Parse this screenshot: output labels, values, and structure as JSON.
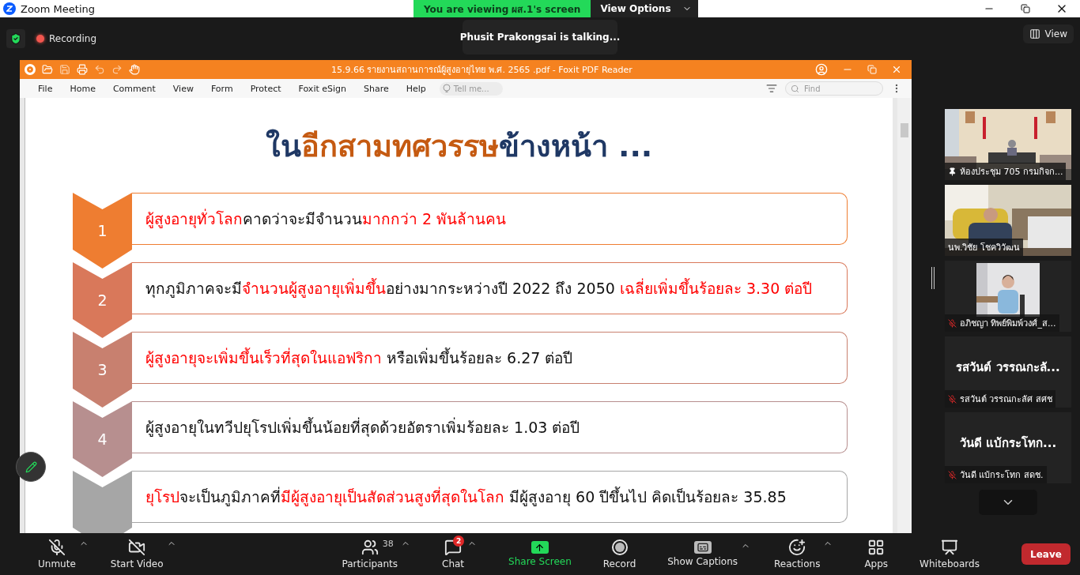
{
  "window": {
    "title": "Zoom Meeting"
  },
  "share_banner": {
    "text": "You are viewing ผส.1's screen",
    "view_options": "View Options"
  },
  "meeting_bar": {
    "recording": "Recording",
    "talking": "Phusit Prakongsai is talking...",
    "view": "View"
  },
  "shared_app": {
    "title": "15.9.66 รายงานสถานการณ์ผู้สูงอายุไทย พ.ศ. 2565 .pdf - Foxit PDF Reader",
    "menu": [
      "File",
      "Home",
      "Comment",
      "View",
      "Form",
      "Protect",
      "Foxit eSign",
      "Share",
      "Help"
    ],
    "tell_me": "Tell me...",
    "find": "Find"
  },
  "slide": {
    "title": [
      {
        "text": "ใน",
        "color": "#1f3864"
      },
      {
        "text": "อีกสามทศวรรษ",
        "color": "#c55a11"
      },
      {
        "text": "ข้างหน้า ...",
        "color": "#1f3864"
      }
    ],
    "items": [
      {
        "number": "1",
        "color": "#ee7d31",
        "parts": [
          {
            "text": "ผู้สูงอายุทั่วโลก",
            "emphasis": true
          },
          {
            "text": "คาดว่าจะมีจำนวน",
            "emphasis": false
          },
          {
            "text": "มากกว่า 2 พันล้านคน",
            "emphasis": true
          }
        ]
      },
      {
        "number": "2",
        "color": "#d9785a",
        "parts": [
          {
            "text": "ทุกภูมิภาคจะมี",
            "emphasis": false
          },
          {
            "text": "จำนวนผู้สูงอายุเพิ่มขึ้น",
            "emphasis": true
          },
          {
            "text": "อย่างมากระหว่างปี 2022 ถึง 2050 ",
            "emphasis": false
          },
          {
            "text": "เฉลี่ยเพิ่มขึ้นร้อยละ 3.30 ต่อปี",
            "emphasis": true
          }
        ]
      },
      {
        "number": "3",
        "color": "#c8806f",
        "parts": [
          {
            "text": "ผู้สูงอายุจะเพิ่มขึ้นเร็วที่สุดในแอฟริกา",
            "emphasis": true
          },
          {
            "text": " หรือเพิ่มขึ้นร้อยละ 6.27 ต่อปี",
            "emphasis": false
          }
        ]
      },
      {
        "number": "4",
        "color": "#b78f8f",
        "parts": [
          {
            "text": "ผู้สูงอายุในทวีปยุโรปเพิ่มขึ้นน้อยที่สุดด้วยอัตราเพิ่มร้อยละ 1.03 ต่อปี",
            "emphasis": false
          }
        ]
      },
      {
        "color": "#a6a6a6",
        "parts": [
          {
            "text": "ยุโรป",
            "emphasis": true
          },
          {
            "text": "จะเป็นภูมิภาคที่",
            "emphasis": false
          },
          {
            "text": "มีผู้สูงอายุเป็นสัดส่วนสูงที่สุดในโลก",
            "emphasis": true
          },
          {
            "text": " มีผู้สูงอายุ 60 ปีขึ้นไป คิดเป็นร้อยละ 35.85",
            "emphasis": false
          }
        ]
      }
    ]
  },
  "participants": [
    {
      "kind": "video",
      "name": "ห้องประชุม 705 กรมกิจก...",
      "pinned": true,
      "muted": false
    },
    {
      "kind": "video",
      "name": "นพ.วิชัย โชควิวัฒน",
      "pinned": false,
      "muted": false
    },
    {
      "kind": "inset",
      "name": "อภิชญา ทิพย์พิมพ์วงศ์_ส...",
      "pinned": false,
      "muted": true
    },
    {
      "kind": "name",
      "display": "รสวันต์ วรรณกะลั...",
      "name": "รสวันต์ วรรณกะลัศ สศช",
      "pinned": false,
      "muted": true
    },
    {
      "kind": "name",
      "display": "วันดี แบ้กระโทก...",
      "name": "วันดี แบ้กระโทก สดช.",
      "pinned": false,
      "muted": true
    }
  ],
  "toolbar": [
    {
      "kind": "mic",
      "label": "Unmute",
      "caret": true
    },
    {
      "kind": "video",
      "label": "Start Video",
      "caret": true
    },
    {
      "kind": "participants",
      "label": "Participants",
      "count": "38",
      "caret": true
    },
    {
      "kind": "chat",
      "label": "Chat",
      "badge": "2",
      "caret": true
    },
    {
      "kind": "share",
      "label": "Share Screen",
      "caret": false
    },
    {
      "kind": "record",
      "label": "Record",
      "caret": false
    },
    {
      "kind": "captions",
      "label": "Show Captions",
      "caret": true
    },
    {
      "kind": "reactions",
      "label": "Reactions",
      "caret": true
    },
    {
      "kind": "apps",
      "label": "Apps",
      "caret": false
    },
    {
      "kind": "whiteboards",
      "label": "Whiteboards",
      "caret": false
    }
  ],
  "leave": "Leave"
}
